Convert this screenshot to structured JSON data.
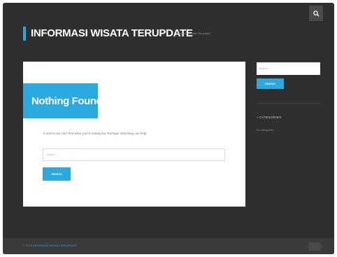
{
  "header": {
    "site_title": "INFORMASI WISATA TERUPDATE",
    "tagline": "Informasi Wisata Terupdate",
    "search_icon": "search-icon"
  },
  "main": {
    "nothing_found_title": "Nothing Found",
    "message": "It seems we can't find what you're looking for. Perhaps searching can help.",
    "search_placeholder": "Search ...",
    "search_button": "SEARCH"
  },
  "sidebar": {
    "search_placeholder": "Search ...",
    "search_button": "SEARCH",
    "categories_heading": "+ CATEGORIES",
    "categories_empty": "No categories"
  },
  "footer": {
    "prefix": "© 2016",
    "link": "INFORMASI WISATA TERUPDATE"
  },
  "colors": {
    "accent": "#2aa8e0",
    "background": "#2f2f2f",
    "card": "#ffffff"
  }
}
